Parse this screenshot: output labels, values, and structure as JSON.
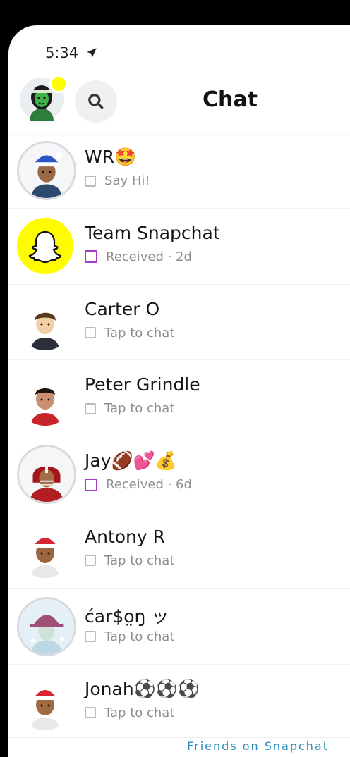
{
  "status": {
    "time": "5:34"
  },
  "header": {
    "title": "Chat"
  },
  "chats": [
    {
      "name": "WR🤩",
      "status": "Say Hi!",
      "indicator": "chat"
    },
    {
      "name": "Team Snapchat",
      "status": "Received · 2d",
      "indicator": "received"
    },
    {
      "name": "Carter O",
      "status": "Tap to chat",
      "indicator": "chat"
    },
    {
      "name": "Peter Grindle",
      "status": "Tap to chat",
      "indicator": "chat"
    },
    {
      "name": "Jay🏈💕💰",
      "status": "Received · 6d",
      "indicator": "received"
    },
    {
      "name": "Antony R",
      "status": "Tap to chat",
      "indicator": "chat"
    },
    {
      "name": "ćar$o̤ŋ ッ",
      "status": "Tap to chat",
      "indicator": "chat"
    },
    {
      "name": "Jonah⚽⚽⚽",
      "status": "Tap to chat",
      "indicator": "chat"
    }
  ],
  "footer": {
    "label": "Friends on Snapchat"
  },
  "colors": {
    "snap_yellow": "#FFFC00",
    "received_purple": "#a43cc8",
    "footer_blue": "#2a8bb7"
  }
}
